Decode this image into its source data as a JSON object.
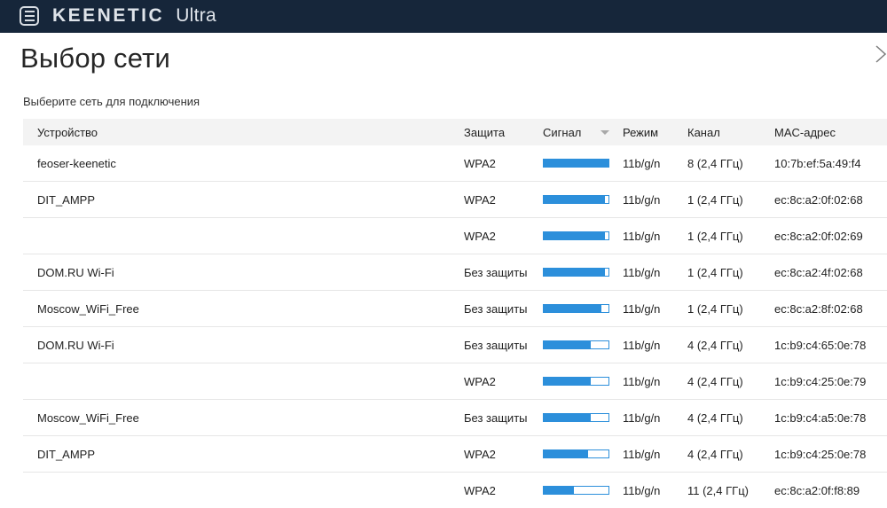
{
  "header": {
    "brand_name": "KEENETIC",
    "brand_model": "Ultra"
  },
  "page": {
    "title": "Выбор сети",
    "subtitle": "Выберите сеть для подключения"
  },
  "table": {
    "columns": {
      "device": "Устройство",
      "security": "Защита",
      "signal": "Сигнал",
      "mode": "Режим",
      "channel": "Канал",
      "mac": "MAC-адрес"
    },
    "sort": {
      "column": "signal",
      "direction": "descending"
    },
    "rows": [
      {
        "device": "feoser-keenetic",
        "security": "WPA2",
        "signal": 1.0,
        "mode": "11b/g/n",
        "channel": "8 (2,4 ГГц)",
        "mac": "10:7b:ef:5a:49:f4"
      },
      {
        "device": "DIT_AMPP",
        "security": "WPA2",
        "signal": 0.95,
        "mode": "11b/g/n",
        "channel": "1 (2,4 ГГц)",
        "mac": "ec:8c:a2:0f:02:68"
      },
      {
        "device": "",
        "security": "WPA2",
        "signal": 0.95,
        "mode": "11b/g/n",
        "channel": "1 (2,4 ГГц)",
        "mac": "ec:8c:a2:0f:02:69"
      },
      {
        "device": "DOM.RU Wi-Fi",
        "security": "Без защиты",
        "signal": 0.95,
        "mode": "11b/g/n",
        "channel": "1 (2,4 ГГц)",
        "mac": "ec:8c:a2:4f:02:68"
      },
      {
        "device": "Moscow_WiFi_Free",
        "security": "Без защиты",
        "signal": 0.89,
        "mode": "11b/g/n",
        "channel": "1 (2,4 ГГц)",
        "mac": "ec:8c:a2:8f:02:68"
      },
      {
        "device": "DOM.RU Wi-Fi",
        "security": "Без защиты",
        "signal": 0.73,
        "mode": "11b/g/n",
        "channel": "4 (2,4 ГГц)",
        "mac": "1c:b9:c4:65:0e:78"
      },
      {
        "device": "",
        "security": "WPA2",
        "signal": 0.73,
        "mode": "11b/g/n",
        "channel": "4 (2,4 ГГц)",
        "mac": "1c:b9:c4:25:0e:79"
      },
      {
        "device": "Moscow_WiFi_Free",
        "security": "Без защиты",
        "signal": 0.73,
        "mode": "11b/g/n",
        "channel": "4 (2,4 ГГц)",
        "mac": "1c:b9:c4:a5:0e:78"
      },
      {
        "device": "DIT_AMPP",
        "security": "WPA2",
        "signal": 0.68,
        "mode": "11b/g/n",
        "channel": "4 (2,4 ГГц)",
        "mac": "1c:b9:c4:25:0e:78"
      },
      {
        "device": "",
        "security": "WPA2",
        "signal": 0.47,
        "mode": "11b/g/n",
        "channel": "11 (2,4 ГГц)",
        "mac": "ec:8c:a2:0f:f8:89"
      }
    ]
  },
  "colors": {
    "header_bg": "#16263a",
    "signal": "#2c8fdb",
    "table_header_bg": "#f3f3f3"
  },
  "icons": {
    "menu": "menu-icon",
    "sort": "sort-desc-icon",
    "next": "chevron-right-icon"
  }
}
